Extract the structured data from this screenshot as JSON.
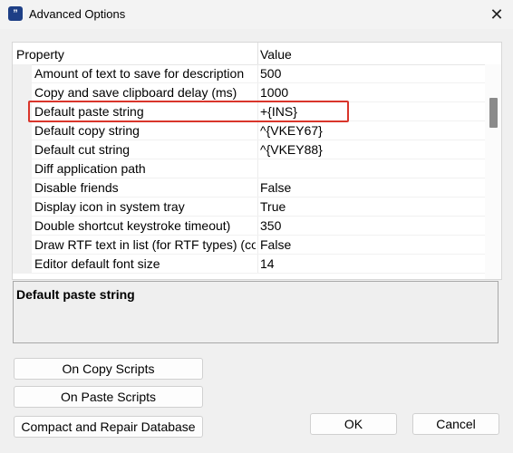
{
  "window": {
    "title": "Advanced Options",
    "app_icon_glyph": "”",
    "close_glyph": "✕"
  },
  "grid": {
    "headers": {
      "property": "Property",
      "value": "Value"
    },
    "rows": [
      {
        "name": "Amount of text to save for description",
        "value": "500"
      },
      {
        "name": "Copy and save clipboard delay (ms)",
        "value": "1000"
      },
      {
        "name": "Default paste string",
        "value": "+{INS}",
        "selected": true
      },
      {
        "name": "Default copy string",
        "value": "^{VKEY67}"
      },
      {
        "name": "Default cut string",
        "value": "^{VKEY88}"
      },
      {
        "name": "Diff application path",
        "value": ""
      },
      {
        "name": "Disable friends",
        "value": "False"
      },
      {
        "name": "Display icon in system tray",
        "value": "True"
      },
      {
        "name": "Double shortcut keystroke timeout)",
        "value": "350"
      },
      {
        "name": "Draw RTF text in list (for RTF types) (co...",
        "value": "False"
      },
      {
        "name": "Editor default font size",
        "value": "14"
      }
    ]
  },
  "description": {
    "title": "Default paste string"
  },
  "buttons": {
    "on_copy_scripts": "On Copy Scripts",
    "on_paste_scripts": "On Paste Scripts",
    "compact_repair": "Compact and Repair Database",
    "ok": "OK",
    "cancel": "Cancel"
  },
  "colors": {
    "highlight_border": "#d9352b",
    "app_icon": "#1e3f86"
  }
}
